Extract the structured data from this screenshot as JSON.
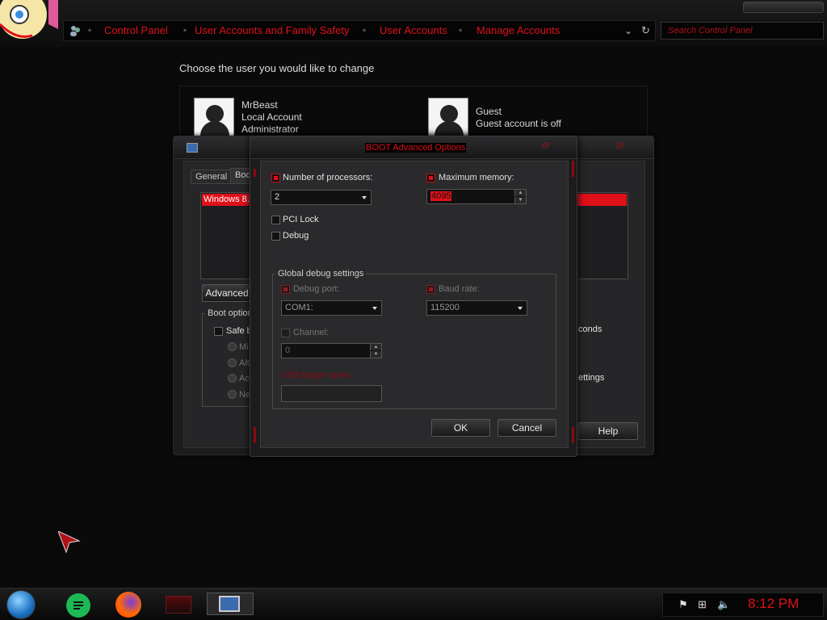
{
  "explorer": {
    "breadcrumbs": [
      "Control Panel",
      "User Accounts and Family Safety",
      "User Accounts",
      "Manage Accounts"
    ],
    "search_placeholder": "Search Control Panel"
  },
  "manage_accounts": {
    "heading": "Choose the user you would like to change",
    "accounts": [
      {
        "name": "MrBeast",
        "line2": "Local Account",
        "line3": "Administrator"
      },
      {
        "name": "Guest",
        "line2": "Guest account is off",
        "line3": ""
      }
    ]
  },
  "msconfig": {
    "tabs": [
      "General",
      "Boot"
    ],
    "boot_entry": "Windows 8.",
    "advanced_button": "Advanced",
    "boot_options_label": "Boot option",
    "safe_boot_label": "Safe b",
    "radios": [
      "Mi",
      "Alt",
      "Ac",
      "Ne"
    ],
    "timeout_fragment": "conds",
    "settings_fragment": "ettings",
    "help_button": "Help"
  },
  "boot_advanced": {
    "title": "BOOT Advanced Options",
    "num_processors": {
      "label": "Number of processors:",
      "checked": true,
      "value": "2"
    },
    "max_memory": {
      "label": "Maximum memory:",
      "checked": true,
      "value": "4095"
    },
    "pci_lock": {
      "label": "PCI Lock",
      "checked": false
    },
    "debug": {
      "label": "Debug",
      "checked": false
    },
    "global_debug": {
      "label": "Global debug settings",
      "debug_port": {
        "label": "Debug port:",
        "value": "COM1:"
      },
      "baud_rate": {
        "label": "Baud rate:",
        "value": "115200"
      },
      "channel": {
        "label": "Channel:",
        "value": "0"
      },
      "usb_target": {
        "label": "USB target name:",
        "value": ""
      }
    },
    "ok_button": "OK",
    "cancel_button": "Cancel"
  },
  "taskbar": {
    "clock": "8:12 PM"
  },
  "colors": {
    "accent": "#e0101a",
    "background": "#0a0a0a"
  }
}
